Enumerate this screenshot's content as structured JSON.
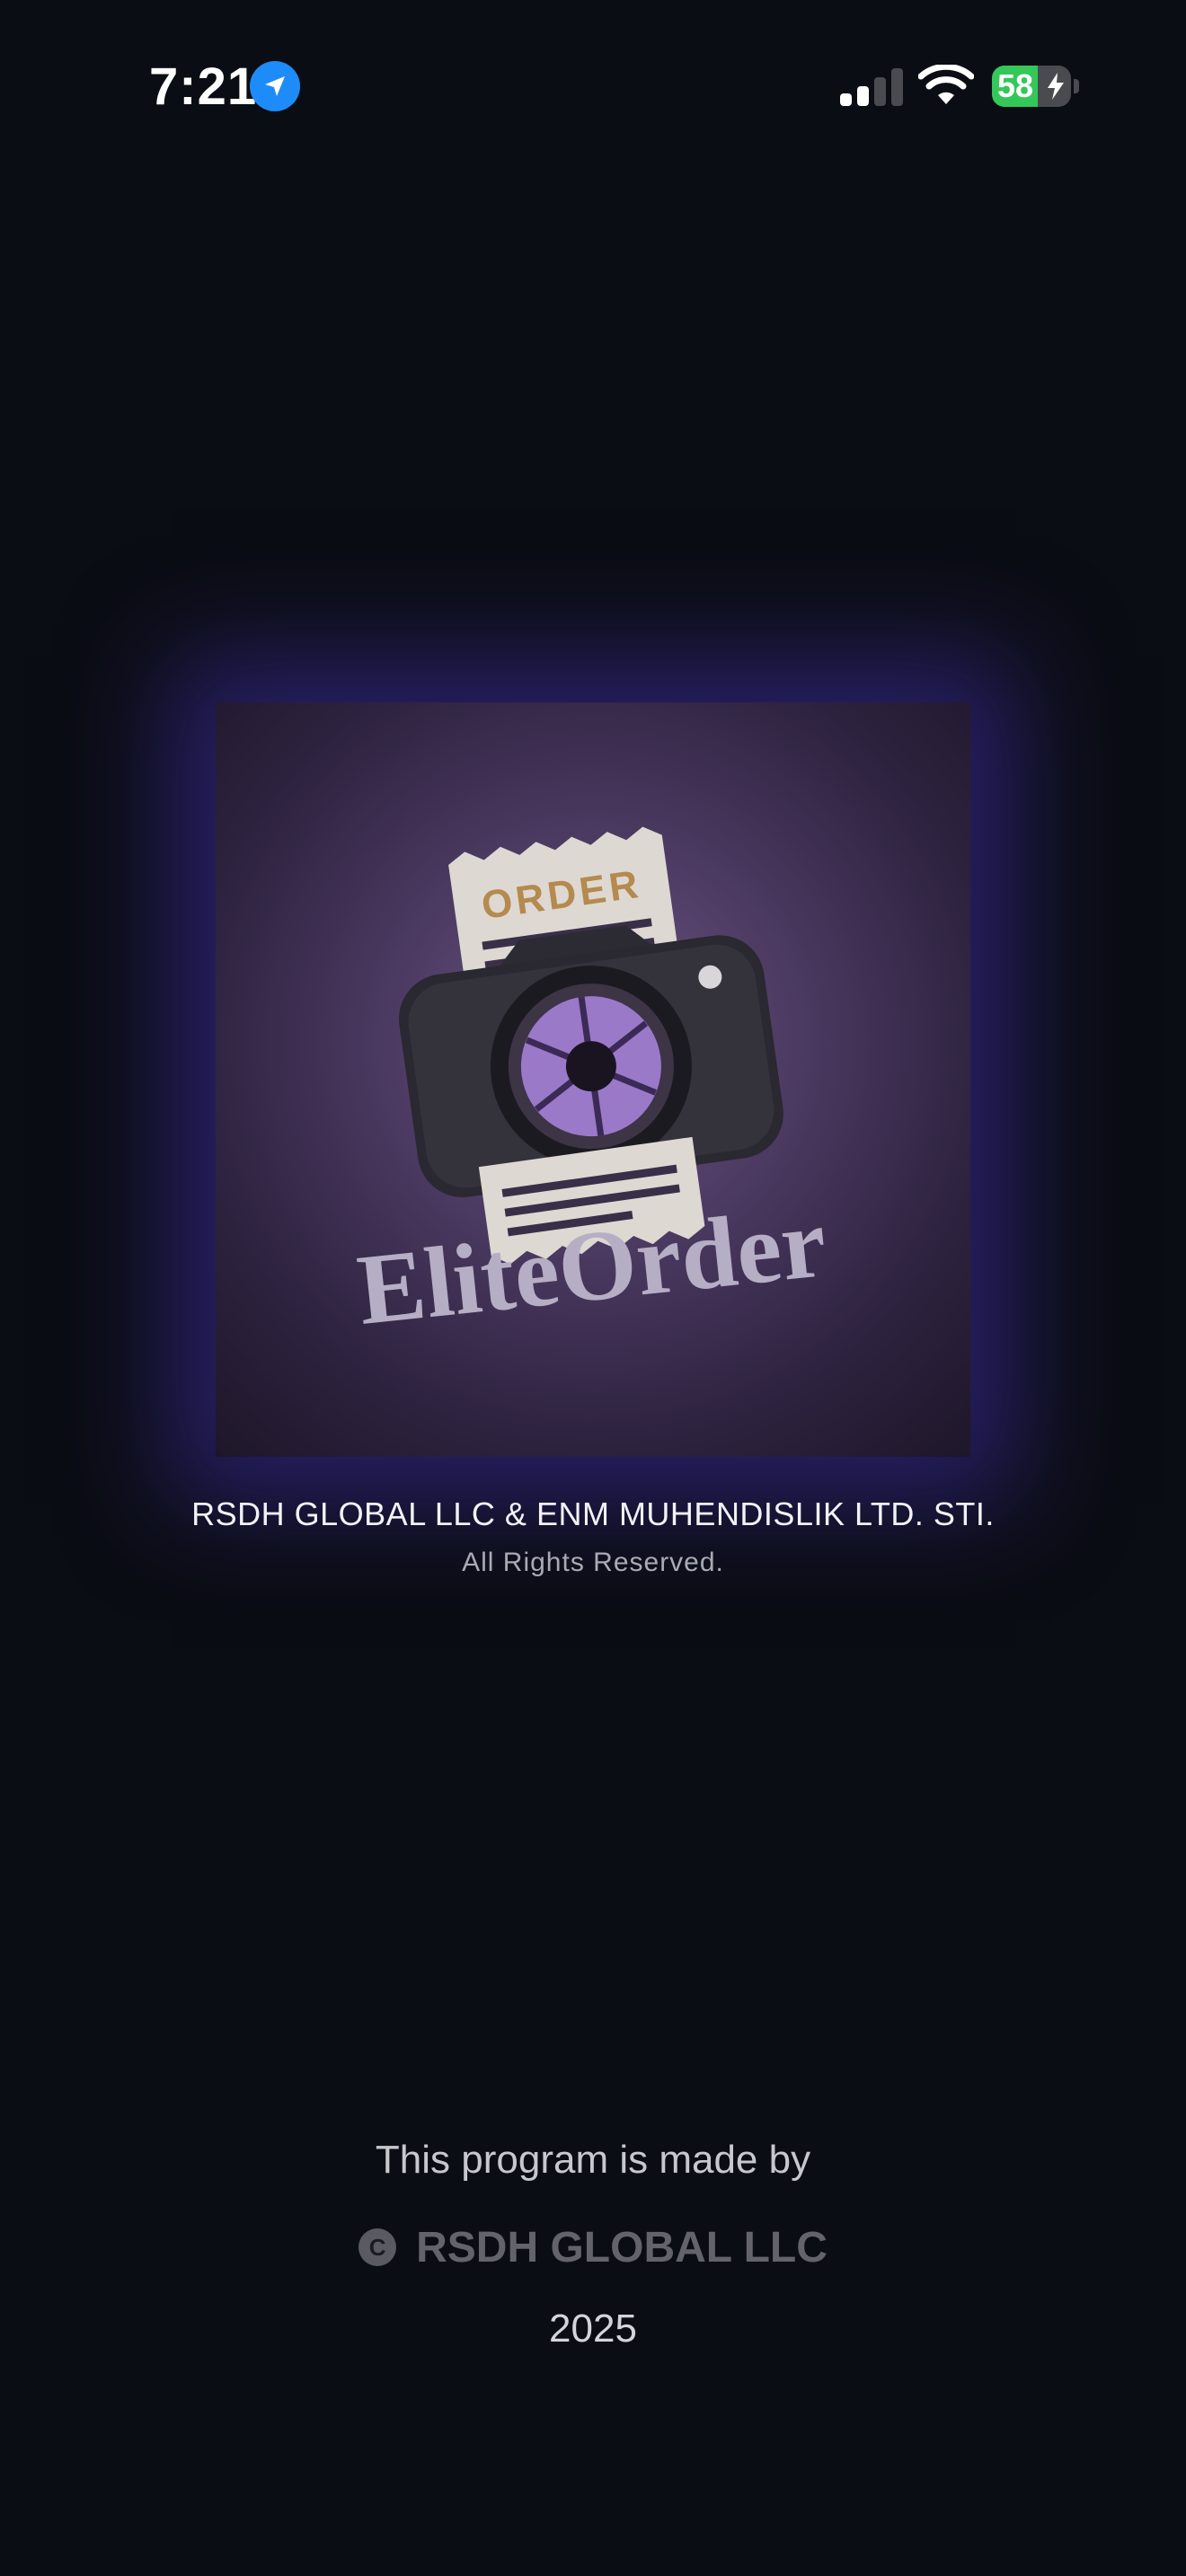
{
  "status_bar": {
    "time": "7:21",
    "battery_level": "58",
    "signal_bars_active": 2,
    "signal_bars_total": 4,
    "icons": [
      "location-arrow-icon",
      "cell-signal-icon",
      "wifi-icon",
      "battery-charging-icon"
    ]
  },
  "logo": {
    "ticket_text": "ORDER",
    "brand_text": "EliteOrder"
  },
  "company": {
    "name": "RSDH GLOBAL LLC & ENM MUHENDISLIK LTD. STI.",
    "rights": "All Rights Reserved."
  },
  "footer": {
    "made_by": "This program is made by",
    "copyright_symbol": "C",
    "owner": "RSDH GLOBAL LLC",
    "year": "2025"
  },
  "colors": {
    "background": "#0b0d14",
    "location_blue": "#1d8cf8",
    "battery_green": "#34c759",
    "glow": "#4030aa",
    "ticket_gold": "#b58a4e",
    "aperture_purple": "#9a79c9"
  }
}
